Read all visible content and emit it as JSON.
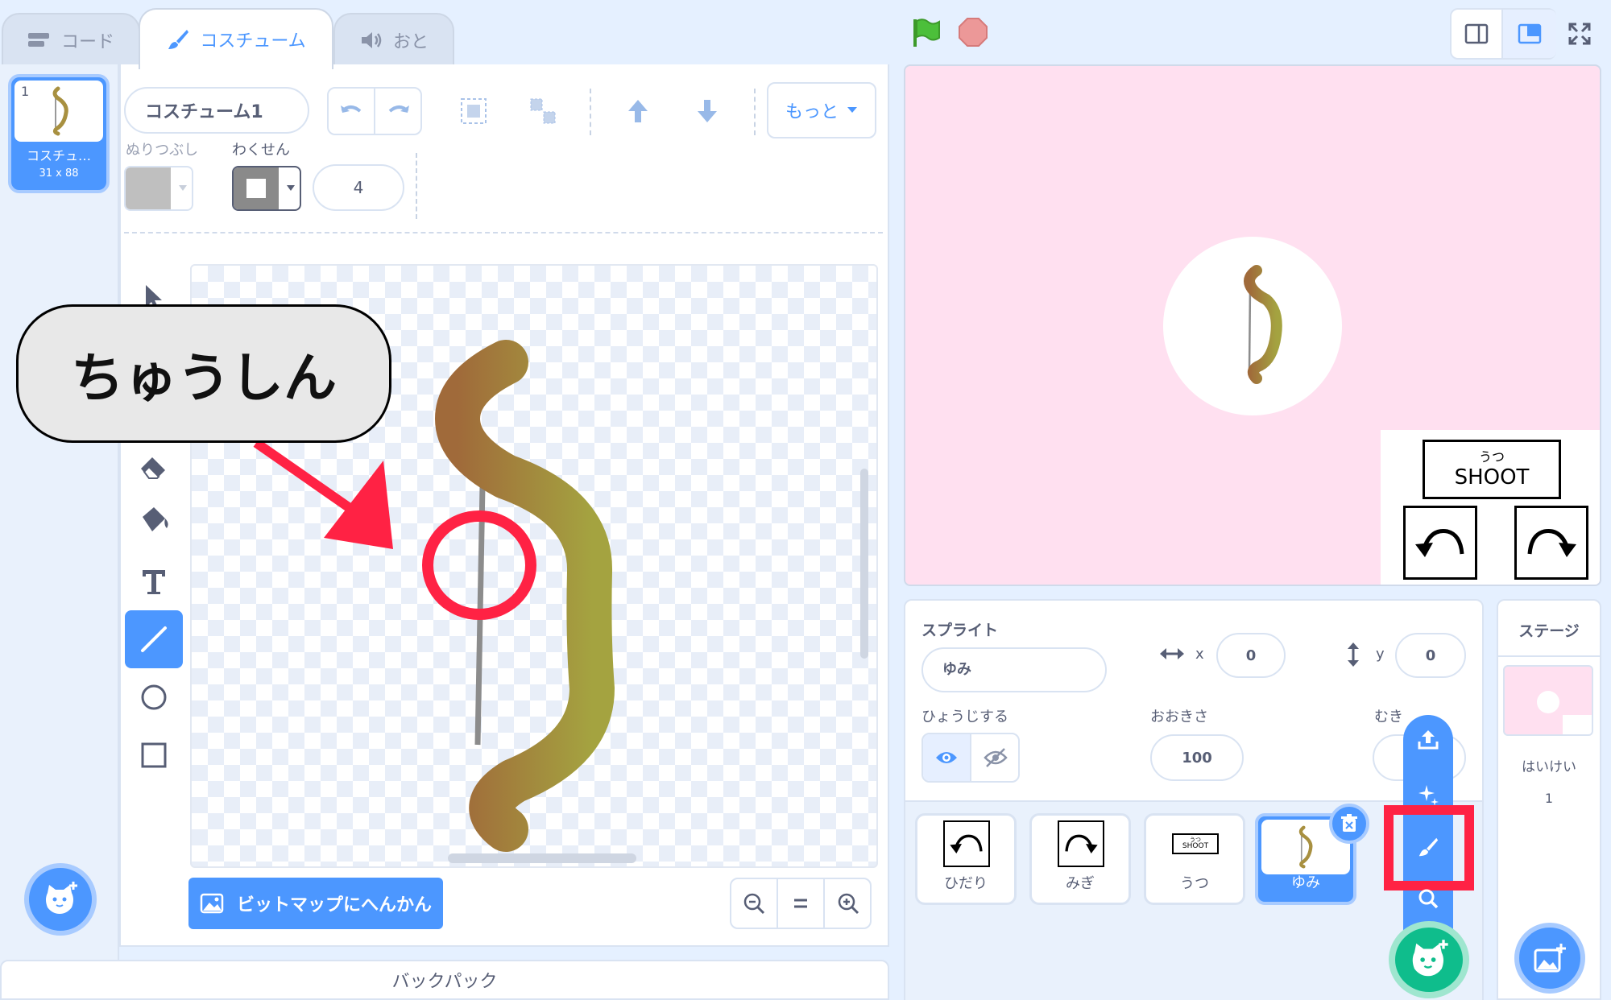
{
  "tabs": {
    "code": "コード",
    "costume": "コスチューム",
    "sound": "おと"
  },
  "costume_list": {
    "item_number": "1",
    "item_name": "コスチュ…",
    "item_size": "31 x 88"
  },
  "editor": {
    "costume_name": "コスチューム1",
    "fill_label": "ぬりつぶし",
    "outline_label": "わくせん",
    "outline_width": "4",
    "more_label": "もっと",
    "convert_bitmap": "ビットマップにへんかん"
  },
  "annotation": {
    "callout_text": "ちゅうしん",
    "accent_color": "#ff3344"
  },
  "sprite_info": {
    "section_label": "スプライト",
    "name_value": "ゆみ",
    "x_label": "x",
    "x_value": "0",
    "y_label": "y",
    "y_value": "0",
    "show_label": "ひょうじする",
    "size_label": "おおきさ",
    "size_value": "100",
    "direction_label": "むき"
  },
  "sprites": [
    {
      "label": "ひだり"
    },
    {
      "label": "みぎ"
    },
    {
      "label": "うつ"
    },
    {
      "label": "ゆみ"
    }
  ],
  "stage_controls": {
    "shoot_ruby": "うつ",
    "shoot_text": "SHOOT"
  },
  "stage_panel": {
    "title": "ステージ",
    "backdrop_label": "はいけい",
    "backdrop_count": "1"
  },
  "backpack": {
    "label": "バックパック"
  },
  "colors": {
    "brand_blue": "#4c97ff",
    "stage_pink": "#ffe0f0",
    "green_fab": "#0fbd8c",
    "highlight_red": "#ff2244"
  }
}
